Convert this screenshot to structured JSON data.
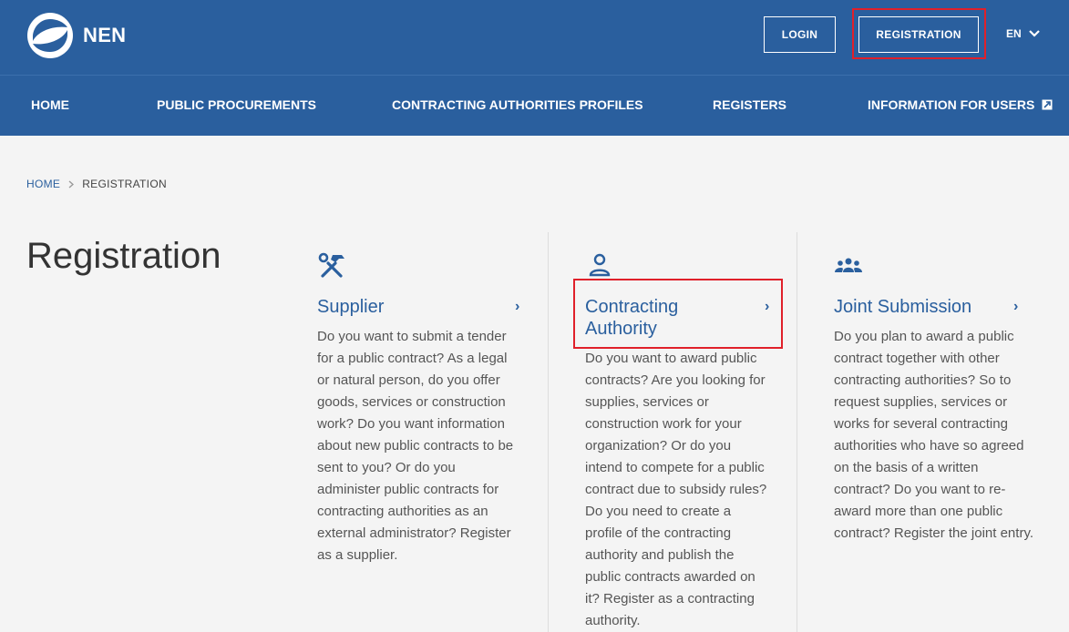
{
  "header": {
    "logo_text": "NEN",
    "login_label": "LOGIN",
    "registration_label": "REGISTRATION",
    "language": "EN"
  },
  "nav": {
    "items": [
      {
        "label": "HOME"
      },
      {
        "label": "PUBLIC PROCUREMENTS"
      },
      {
        "label": "CONTRACTING AUTHORITIES PROFILES"
      },
      {
        "label": "REGISTERS"
      },
      {
        "label": "INFORMATION FOR USERS"
      }
    ]
  },
  "breadcrumb": {
    "home": "HOME",
    "current": "REGISTRATION"
  },
  "page": {
    "title": "Registration"
  },
  "cards": [
    {
      "icon": "tools-icon",
      "title": "Supplier",
      "text": "Do you want to submit a tender for a public contract? As a legal or natural person, do you offer goods, services or construction work? Do you want information about new public contracts to be sent to you? Or do you administer public contracts for contracting authorities as an external administrator? Register as a supplier."
    },
    {
      "icon": "person-icon",
      "title": "Contracting Authority",
      "text": "Do you want to award public contracts? Are you looking for supplies, services or construction work for your organization? Or do you intend to compete for a public contract due to subsidy rules? Do you need to create a profile of the contracting authority and publish the public contracts awarded on it? Register as a contracting authority."
    },
    {
      "icon": "group-icon",
      "title": "Joint Submission",
      "text": "Do you plan to award a public contract together with other contracting authorities? So to request supplies, services or works for several contracting authorities who have so agreed on the basis of a written contract? Do you want to re-award more than one public contract? Register the joint entry."
    }
  ],
  "colors": {
    "brand": "#2a5f9e",
    "highlight": "#e0202a",
    "background": "#f4f4f4"
  }
}
